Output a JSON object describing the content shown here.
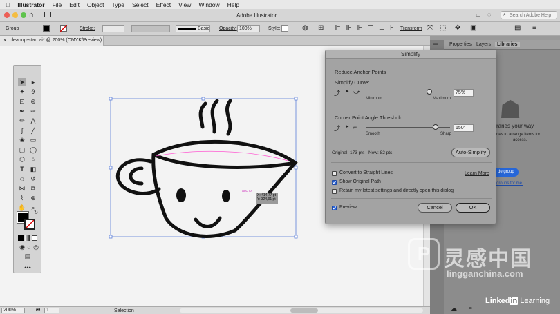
{
  "menubar": {
    "apple": "",
    "app": "Illustrator",
    "items": [
      "File",
      "Edit",
      "Object",
      "Type",
      "Select",
      "Effect",
      "View",
      "Window",
      "Help"
    ]
  },
  "appbar": {
    "title": "Adobe Illustrator",
    "search_placeholder": "Search Adobe Help"
  },
  "control": {
    "selection": "Group",
    "stroke_label": "Stroke:",
    "brush": "Basic",
    "opacity_label": "Opacity:",
    "opacity_value": "100%",
    "style_label": "Style:",
    "transform": "Transform"
  },
  "document_tab": {
    "title": "cleanup-start.ai* @ 200% (CMYK/Preview)"
  },
  "canvas": {
    "smart_guide": "anchor",
    "tooltip_x": "X: 414,77 pt",
    "tooltip_y": "Y: 324,91 pt"
  },
  "status": {
    "zoom": "200%",
    "artboard": "1",
    "tool": "Selection"
  },
  "panel": {
    "tabs": [
      "Properties",
      "Layers",
      "Libraries"
    ],
    "lib_text1": "raries your way",
    "lib_text2": "ries to arrange items for",
    "lib_text3": "access.",
    "lib_btn": "de group",
    "lib_link": "groups for me."
  },
  "dialog": {
    "title": "Simplify",
    "group": "Reduce Anchor Points",
    "curve_label": "Simplify Curve:",
    "curve_min": "Minimum",
    "curve_max": "Maximum",
    "curve_value": "75%",
    "curve_level": 0.75,
    "angle_label": "Corner Point Angle Threshold:",
    "angle_min": "Smooth",
    "angle_max": "Sharp",
    "angle_value": "150°",
    "angle_level": 0.83,
    "original": "Original: 173 pts",
    "new": "New: 82 pts",
    "auto": "Auto-Simplify",
    "opt_straight": "Convert to Straight Lines",
    "opt_straight_checked": false,
    "opt_show": "Show Original Path",
    "opt_show_checked": true,
    "opt_retain": "Retain my latest settings and directly open this dialog",
    "opt_retain_checked": false,
    "learn": "Learn More",
    "preview": "Preview",
    "preview_checked": true,
    "cancel": "Cancel",
    "ok": "OK"
  },
  "watermark": {
    "linkedin": "Linked",
    "in": "in",
    "learning": "Learning",
    "site": "lingganchina.com",
    "cn": "灵感中国"
  }
}
